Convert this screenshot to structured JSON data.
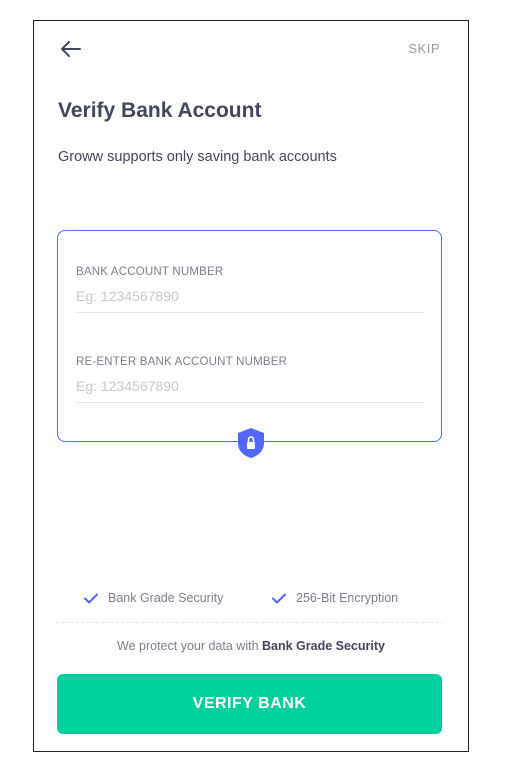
{
  "header": {
    "back_icon": "arrow-left-icon",
    "skip_label": "SKIP"
  },
  "page": {
    "title": "Verify Bank Account",
    "subtitle": "Groww supports only saving bank accounts"
  },
  "form": {
    "account_number_label": "BANK ACCOUNT NUMBER",
    "account_number_placeholder": "Eg: 1234567890",
    "account_number_value": "",
    "reenter_label": "RE-ENTER BANK ACCOUNT NUMBER",
    "reenter_placeholder": "Eg: 1234567890",
    "reenter_value": "",
    "shield_icon": "shield-lock-icon"
  },
  "security": {
    "badges": [
      {
        "icon": "check-icon",
        "label": "Bank Grade Security"
      },
      {
        "icon": "check-icon",
        "label": "256-Bit Encryption"
      }
    ],
    "protect_prefix": "We protect your data with ",
    "protect_emphasis": "Bank Grade Security"
  },
  "footer": {
    "verify_label": "VERIFY BANK"
  },
  "colors": {
    "accent_blue": "#5367ff",
    "primary_green": "#00d09c",
    "text_dark": "#44475b",
    "text_muted": "#7c7e8c"
  }
}
